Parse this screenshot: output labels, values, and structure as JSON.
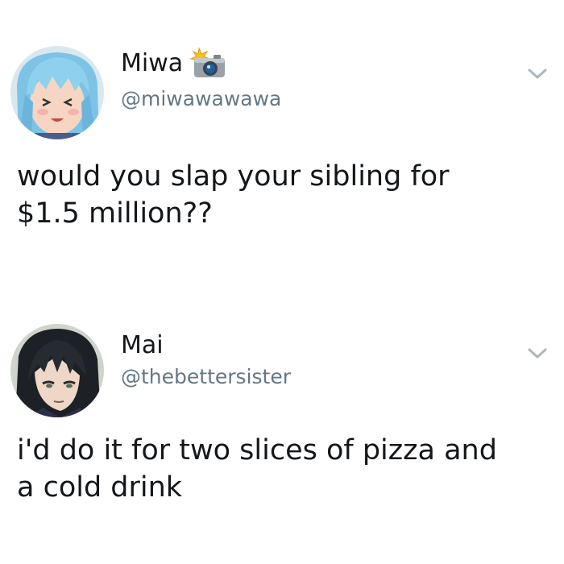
{
  "tweets": [
    {
      "display_name": "Miwa",
      "handle": "@miwawawawa",
      "text": "would you slap your sibling for\n$1.5 million??",
      "name_icon": "camera-flash-icon",
      "menu_icon": "chevron-down-icon"
    },
    {
      "display_name": "Mai",
      "handle": "@thebettersister",
      "text": "i'd do it for two slices of pizza and\na cold drink",
      "menu_icon": "chevron-down-icon"
    }
  ],
  "colors": {
    "text": "#14171a",
    "handle": "#657786",
    "chevron": "#aab8c2",
    "background": "#ffffff"
  }
}
